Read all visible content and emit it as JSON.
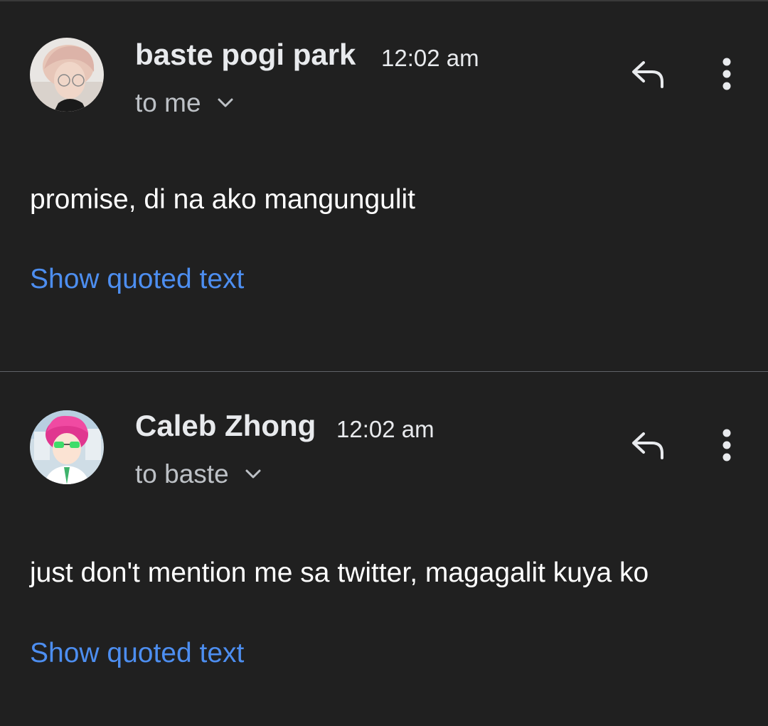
{
  "messages": [
    {
      "sender": "baste pogi park",
      "time": "12:02 am",
      "recipient": "to me",
      "body": "promise, di na ako mangungulit",
      "quoted_link": "Show quoted text"
    },
    {
      "sender": "Caleb Zhong",
      "time": "12:02 am",
      "recipient": "to baste",
      "body": "just don't mention me sa twitter, magagalit kuya ko",
      "quoted_link": "Show quoted text"
    }
  ],
  "icons": {
    "reply": "reply-arrow-icon",
    "more": "more-vert-icon",
    "expand": "chevron-down-icon"
  },
  "colors": {
    "background": "#202020",
    "link": "#4d8ef0",
    "divider": "#5f6368",
    "secondary_text": "#bdc1c6"
  }
}
